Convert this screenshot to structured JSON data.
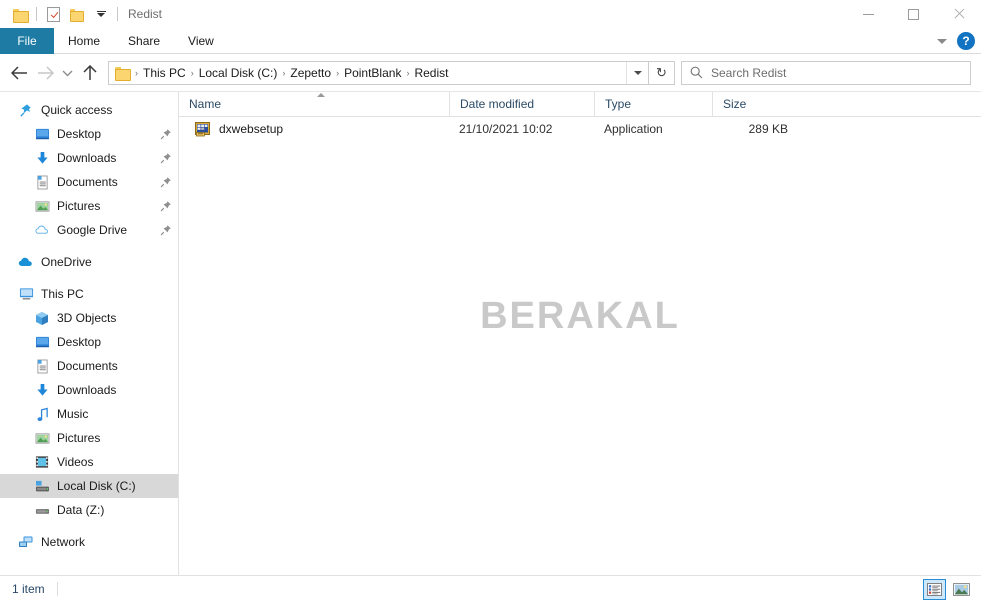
{
  "window": {
    "title": "Redist",
    "quick_access_toolbar": [
      {
        "name": "folder-icon",
        "label": "Folder"
      },
      {
        "name": "properties-icon",
        "label": "Properties"
      },
      {
        "name": "new-folder-icon",
        "label": "New folder"
      },
      {
        "name": "customize-quick-access-chevron",
        "label": "Customize Quick Access Toolbar"
      }
    ],
    "controls": {
      "minimize": "Minimize",
      "maximize": "Maximize",
      "close": "Close"
    }
  },
  "ribbon": {
    "tabs": [
      {
        "label": "File",
        "active": true
      },
      {
        "label": "Home",
        "active": false
      },
      {
        "label": "Share",
        "active": false
      },
      {
        "label": "View",
        "active": false
      }
    ],
    "expand_label": "Expand the Ribbon",
    "help_label": "?"
  },
  "navigation": {
    "back": "Back",
    "forward": "Forward",
    "recent": "Recent locations",
    "up": "Up",
    "breadcrumbs": [
      "This PC",
      "Local Disk (C:)",
      "Zepetto",
      "PointBlank",
      "Redist"
    ],
    "breadcrumb_separator": "›",
    "refresh": "↻",
    "address_dropdown": "Previous locations"
  },
  "search": {
    "placeholder": "Search Redist",
    "icon": "search-icon"
  },
  "sidebar": {
    "groups": [
      {
        "name": "quick-access",
        "label": "Quick access",
        "icon": "pin-star-icon",
        "level": 0,
        "selected": false,
        "items": [
          {
            "label": "Desktop",
            "icon": "desktop-icon",
            "pinned": true
          },
          {
            "label": "Downloads",
            "icon": "downloads-icon",
            "pinned": true
          },
          {
            "label": "Documents",
            "icon": "documents-icon",
            "pinned": true
          },
          {
            "label": "Pictures",
            "icon": "pictures-icon",
            "pinned": true
          },
          {
            "label": "Google Drive",
            "icon": "google-drive-icon",
            "pinned": true
          }
        ]
      },
      {
        "name": "onedrive",
        "label": "OneDrive",
        "icon": "onedrive-cloud-icon",
        "level": 0,
        "selected": false,
        "items": []
      },
      {
        "name": "this-pc",
        "label": "This PC",
        "icon": "this-pc-icon",
        "level": 0,
        "selected": false,
        "items": [
          {
            "label": "3D Objects",
            "icon": "3d-objects-icon",
            "pinned": false
          },
          {
            "label": "Desktop",
            "icon": "desktop-icon",
            "pinned": false
          },
          {
            "label": "Documents",
            "icon": "documents-icon",
            "pinned": false
          },
          {
            "label": "Downloads",
            "icon": "downloads-icon",
            "pinned": false
          },
          {
            "label": "Music",
            "icon": "music-icon",
            "pinned": false
          },
          {
            "label": "Pictures",
            "icon": "pictures-icon",
            "pinned": false
          },
          {
            "label": "Videos",
            "icon": "videos-icon",
            "pinned": false
          },
          {
            "label": "Local Disk (C:)",
            "icon": "hard-drive-icon",
            "pinned": false,
            "selected": true
          },
          {
            "label": "Data (Z:)",
            "icon": "drive-icon",
            "pinned": false
          }
        ]
      },
      {
        "name": "network",
        "label": "Network",
        "icon": "network-icon",
        "level": 0,
        "selected": false,
        "items": []
      }
    ]
  },
  "filelist": {
    "columns": [
      {
        "key": "name",
        "label": "Name",
        "sorted": "asc"
      },
      {
        "key": "date",
        "label": "Date modified",
        "sorted": null
      },
      {
        "key": "type",
        "label": "Type",
        "sorted": null
      },
      {
        "key": "size",
        "label": "Size",
        "sorted": null
      }
    ],
    "rows": [
      {
        "name": "dxwebsetup",
        "date": "21/10/2021 10:02",
        "type": "Application",
        "size": "289 KB",
        "icon": "application-setup-icon"
      }
    ]
  },
  "watermark": {
    "text": "BERAKAL"
  },
  "statusbar": {
    "item_count": "1 item",
    "views": [
      {
        "name": "details-view",
        "label": "Details view",
        "active": true
      },
      {
        "name": "large-icons-view",
        "label": "Large icons view",
        "active": false
      }
    ]
  },
  "colors": {
    "file_tab": "#1e7ba4",
    "help_button": "#1173c1",
    "selection": "#d8d8d8",
    "view_active": "#cde8fa",
    "watermark": "#c9c9c9"
  }
}
